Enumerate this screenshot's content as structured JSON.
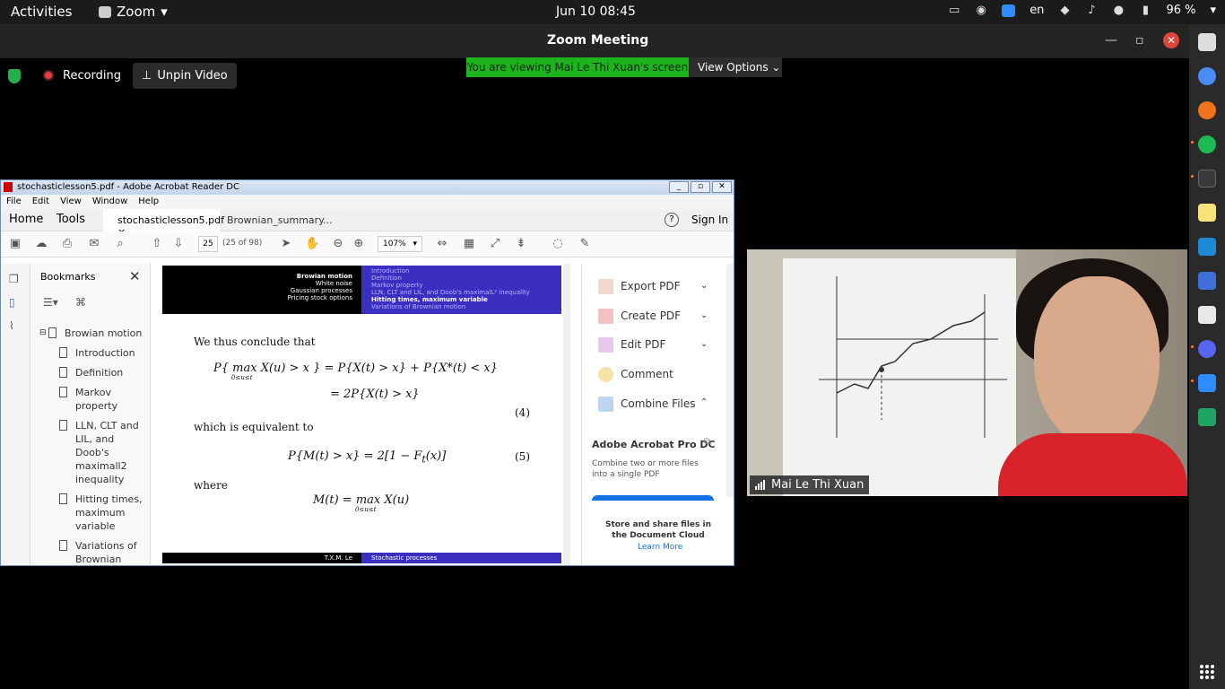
{
  "topbar": {
    "activities": "Activities",
    "app_name": "Zoom",
    "clock": "Jun 10  08:45",
    "language": "en",
    "battery": "96 %"
  },
  "zoom": {
    "title": "Zoom Meeting",
    "recording_label": "Recording",
    "unpin_label": "Unpin Video",
    "banner": "You are viewing Mai Le Thi Xuan's screen",
    "view_options": "View Options",
    "participant_name": "Mai Le Thi Xuan"
  },
  "acrobat": {
    "window_title": "stochasticlesson5.pdf - Adobe Acrobat Reader DC",
    "menu": [
      "File",
      "Edit",
      "View",
      "Window",
      "Help"
    ],
    "nav_home": "Home",
    "nav_tools": "Tools",
    "tab_active": "stochasticlesson5.pdf",
    "tab_other": "Brownian_summary...",
    "sign_in": "Sign In",
    "page_current": "25",
    "page_of": "(25 of 98)",
    "zoom_level": "107%",
    "bookmarks_title": "Bookmarks",
    "bookmarks": {
      "root": "Browian motion",
      "items": [
        "Introduction",
        "Definition",
        "Markov property",
        "LLN, CLT and LIL, and Doob's maximall2 inequality",
        "Hitting times, maximum variable",
        "Variations of Brownian"
      ]
    },
    "slide": {
      "head_left": [
        "Browian motion",
        "White noise",
        "Gaussian processes",
        "Pricing stock options"
      ],
      "head_right": [
        "Introduction",
        "Definition",
        "Markov property",
        "LLN, CLT and LIL, and Doob's maximalL² inequality",
        "Hitting times, maximum variable",
        "Variations of Brownian motion"
      ],
      "text1": "We thus conclude that",
      "text2": "which is equivalent to",
      "text3": "where",
      "eq_num1": "(4)",
      "eq_num2": "(5)",
      "foot_left": "T.X.M. Le",
      "foot_right": "Stochastic processes"
    },
    "right_pane": {
      "export": "Export PDF",
      "create": "Create PDF",
      "edit": "Edit PDF",
      "comment": "Comment",
      "combine": "Combine Files",
      "promo_title": "Adobe Acrobat Pro DC",
      "promo_text": "Combine two or more files into a single PDF",
      "store_text": "Store and share files in the Document Cloud",
      "learn_more": "Learn More"
    }
  },
  "colors": {
    "zoom_green": "#1db31d",
    "recording_red": "#e03e3e",
    "slide_blue": "#3a2fc0",
    "acrobat_blue": "#1473e6"
  }
}
